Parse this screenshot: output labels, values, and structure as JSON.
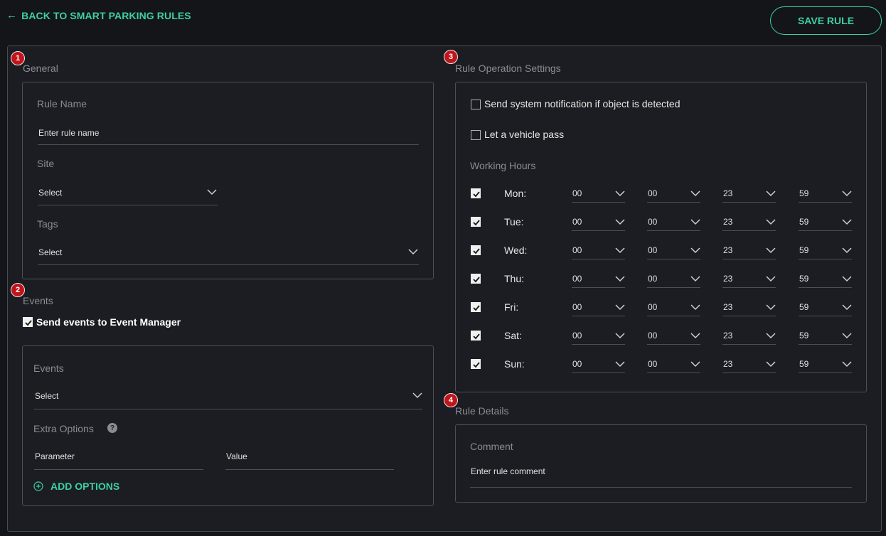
{
  "header": {
    "back_label": "BACK TO SMART PARKING RULES",
    "save_label": "SAVE RULE"
  },
  "general": {
    "badge": "1",
    "title": "General",
    "rule_name_label": "Rule Name",
    "rule_name_placeholder": "Enter rule name",
    "site_label": "Site",
    "site_value": "Select",
    "tags_label": "Tags",
    "tags_value": "Select"
  },
  "events": {
    "badge": "2",
    "title": "Events",
    "send_events_label": "Send events to Event Manager",
    "send_events_checked": true,
    "events_label": "Events",
    "events_value": "Select",
    "extra_options_label": "Extra Options",
    "help_glyph": "?",
    "parameter_placeholder": "Parameter",
    "value_placeholder": "Value",
    "add_options_label": "ADD OPTIONS"
  },
  "operation": {
    "badge": "3",
    "title": "Rule Operation Settings",
    "notify_label": "Send system notification if object is detected",
    "notify_checked": false,
    "pass_label": "Let a vehicle pass",
    "pass_checked": false,
    "working_hours_label": "Working Hours",
    "days": [
      {
        "day": "Mon:",
        "checked": true,
        "from_h": "00",
        "from_m": "00",
        "to_h": "23",
        "to_m": "59"
      },
      {
        "day": "Tue:",
        "checked": true,
        "from_h": "00",
        "from_m": "00",
        "to_h": "23",
        "to_m": "59"
      },
      {
        "day": "Wed:",
        "checked": true,
        "from_h": "00",
        "from_m": "00",
        "to_h": "23",
        "to_m": "59"
      },
      {
        "day": "Thu:",
        "checked": true,
        "from_h": "00",
        "from_m": "00",
        "to_h": "23",
        "to_m": "59"
      },
      {
        "day": "Fri:",
        "checked": true,
        "from_h": "00",
        "from_m": "00",
        "to_h": "23",
        "to_m": "59"
      },
      {
        "day": "Sat:",
        "checked": true,
        "from_h": "00",
        "from_m": "00",
        "to_h": "23",
        "to_m": "59"
      },
      {
        "day": "Sun:",
        "checked": true,
        "from_h": "00",
        "from_m": "00",
        "to_h": "23",
        "to_m": "59"
      }
    ]
  },
  "details": {
    "badge": "4",
    "title": "Rule Details",
    "comment_label": "Comment",
    "comment_placeholder": "Enter rule comment"
  },
  "colors": {
    "accent": "#3ecfa2",
    "badge": "#c0151b",
    "background": "#141519",
    "panel": "#1c1d22"
  }
}
